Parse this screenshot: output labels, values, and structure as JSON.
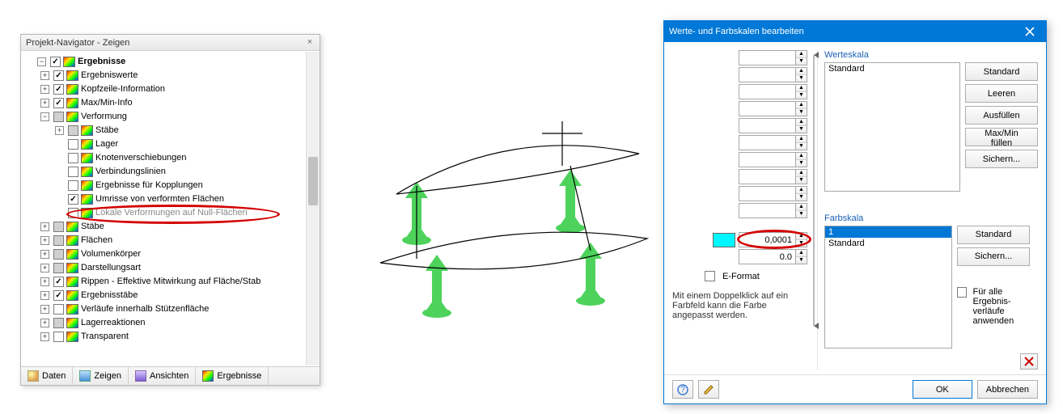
{
  "navigator": {
    "title": "Projekt-Navigator - Zeigen",
    "tabs": {
      "daten": "Daten",
      "zeigen": "Zeigen",
      "ansichten": "Ansichten",
      "ergebnisse": "Ergebnisse"
    },
    "root": {
      "label": "Ergebnisse",
      "items": [
        {
          "label": "Ergebniswerte",
          "checked": true,
          "expandable": true
        },
        {
          "label": "Kopfzeile-Information",
          "checked": true,
          "expandable": true
        },
        {
          "label": "Max/Min-Info",
          "checked": true,
          "expandable": true
        },
        {
          "label": "Verformung",
          "checked": "mixed",
          "expandable": true,
          "expanded": true,
          "children": [
            {
              "label": "Stäbe",
              "checked": "mixed",
              "swatch": true,
              "expandable": true
            },
            {
              "label": "Lager",
              "checked": false,
              "swatch": true
            },
            {
              "label": "Knotenverschiebungen",
              "checked": false,
              "swatch": true
            },
            {
              "label": "Verbindungslinien",
              "checked": false,
              "swatch": true
            },
            {
              "label": "Ergebnisse für Kopplungen",
              "checked": false,
              "swatch": true
            },
            {
              "label": "Umrisse von verformten Flächen",
              "checked": true,
              "swatch": true,
              "highlighted": true
            },
            {
              "label": "Lokale Verformungen auf Null-Flächen",
              "checked": false,
              "swatch": true
            }
          ]
        },
        {
          "label": "Stäbe",
          "checked": "mixed",
          "expandable": true
        },
        {
          "label": "Flächen",
          "checked": "mixed",
          "expandable": true
        },
        {
          "label": "Volumenkörper",
          "checked": "mixed",
          "expandable": true
        },
        {
          "label": "Darstellungsart",
          "checked": "mixed",
          "expandable": true
        },
        {
          "label": "Rippen - Effektive Mitwirkung auf Fläche/Stab",
          "checked": true,
          "expandable": true
        },
        {
          "label": "Ergebnisstäbe",
          "checked": true,
          "expandable": true
        },
        {
          "label": "Verläufe innerhalb Stützenfläche",
          "checked": false,
          "expandable": true
        },
        {
          "label": "Lagerreaktionen",
          "checked": "mixed",
          "expandable": true
        },
        {
          "label": "Transparent",
          "checked": false,
          "expandable": true
        }
      ]
    }
  },
  "dialog": {
    "title": "Werte- und Farbskalen bearbeiten",
    "spinners": [
      "",
      "",
      "",
      "",
      "",
      "",
      "",
      "",
      "",
      "",
      "0,0001",
      "0.0"
    ],
    "active_color": "#00f7ff",
    "eformat_label": "E-Format",
    "eformat_checked": false,
    "help": "Mit einem Doppelklick auf ein Farbfeld kann die Farbe angepasst werden.",
    "werteskala": {
      "title": "Werteskala",
      "items": [
        "Standard"
      ],
      "buttons": {
        "standard": "Standard",
        "leeren": "Leeren",
        "ausfuellen": "Ausfüllen",
        "maxmin": "Max/Min füllen",
        "sichern": "Sichern..."
      }
    },
    "farbskala": {
      "title": "Farbskala",
      "items": [
        "1",
        "Standard"
      ],
      "selected_index": 0,
      "buttons": {
        "standard": "Standard",
        "sichern": "Sichern..."
      },
      "apply_all_label": "Für alle Ergebnis-\nverläufe anwenden",
      "apply_all_checked": false
    },
    "footer": {
      "ok": "OK",
      "cancel": "Abbrechen"
    }
  }
}
